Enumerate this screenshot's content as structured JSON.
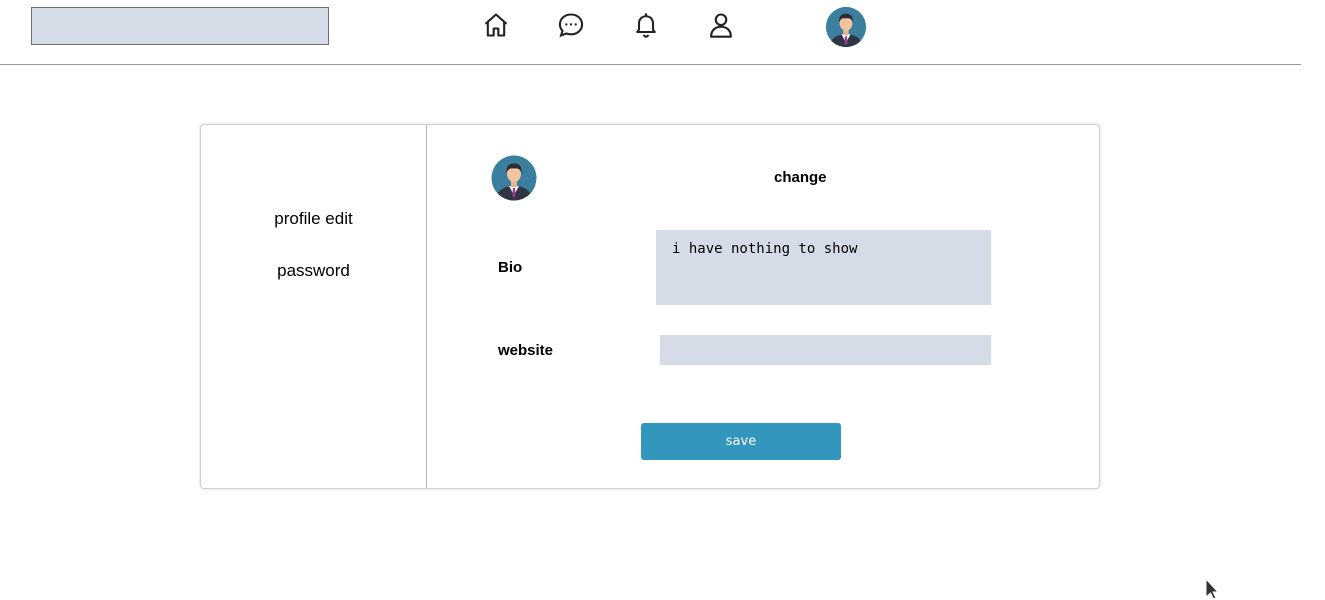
{
  "header": {
    "search": {
      "value": "",
      "placeholder": ""
    },
    "nav_icons": [
      "home-icon",
      "chat-icon",
      "bell-icon",
      "user-icon"
    ]
  },
  "sidebar": {
    "items": [
      {
        "label": "profile edit"
      },
      {
        "label": "password"
      }
    ]
  },
  "profile": {
    "change_label": "change",
    "bio_label": "Bio",
    "bio_value": "i have nothing to show",
    "website_label": "website",
    "website_value": "",
    "save_label": "save"
  },
  "colors": {
    "input_bg": "#d5dce8",
    "save_button": "#3296bd",
    "avatar_bg": "#3a7f9e"
  }
}
